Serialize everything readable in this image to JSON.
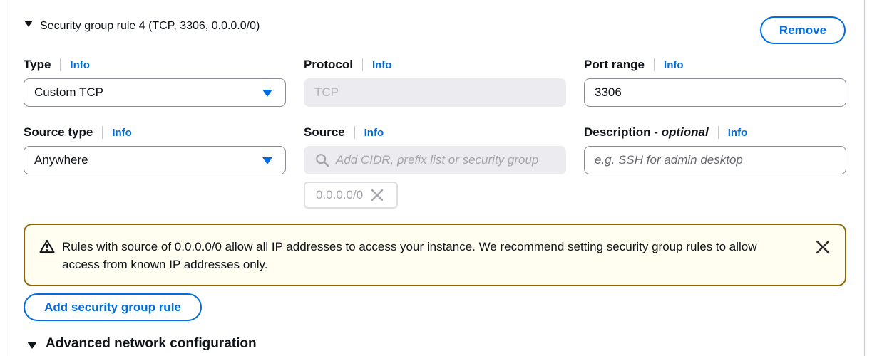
{
  "rule": {
    "header": "Security group rule 4 (TCP, 3306, 0.0.0.0/0)",
    "remove_label": "Remove"
  },
  "info_label": "Info",
  "fields": {
    "type": {
      "label": "Type",
      "value": "Custom TCP"
    },
    "protocol": {
      "label": "Protocol",
      "value": "TCP"
    },
    "port_range": {
      "label": "Port range",
      "value": "3306"
    },
    "source_type": {
      "label": "Source type",
      "value": "Anywhere"
    },
    "source": {
      "label": "Source",
      "placeholder": "Add CIDR, prefix list or security group"
    },
    "description": {
      "label": "Description",
      "label_suffix": "optional",
      "placeholder": "e.g. SSH for admin desktop"
    }
  },
  "source_token": "0.0.0.0/0",
  "alert": {
    "message": "Rules with source of 0.0.0.0/0 allow all IP addresses to access your instance. We recommend setting security group rules to allow access from known IP addresses only."
  },
  "add_rule_label": "Add security group rule",
  "advanced_label": "Advanced network configuration",
  "colors": {
    "accent": "#006ce0",
    "warning_border": "#8d6605",
    "warning_bg": "#fffef0"
  },
  "icons": {
    "expand": "caret-down-icon",
    "select": "caret-down-icon",
    "search": "search-icon",
    "remove_token": "close-icon",
    "warning": "warning-icon",
    "dismiss": "close-icon"
  }
}
